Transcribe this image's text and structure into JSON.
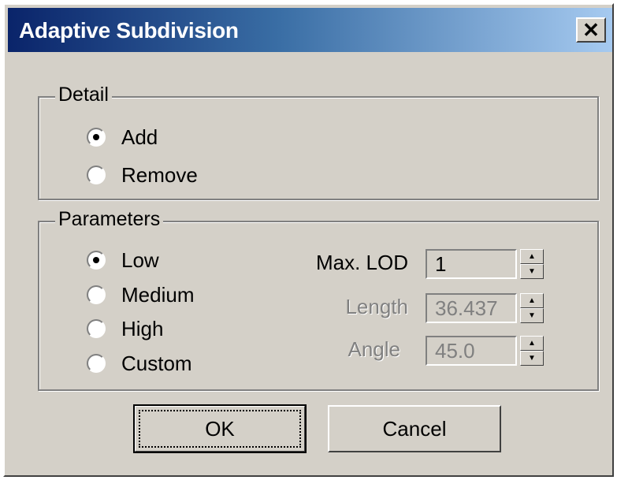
{
  "window": {
    "title": "Adaptive Subdivision",
    "close_glyph": "✕"
  },
  "detail": {
    "label": "Detail",
    "options": [
      {
        "label": "Add",
        "selected": true
      },
      {
        "label": "Remove",
        "selected": false
      }
    ]
  },
  "parameters": {
    "label": "Parameters",
    "options": [
      {
        "label": "Low",
        "selected": true
      },
      {
        "label": "Medium",
        "selected": false
      },
      {
        "label": "High",
        "selected": false
      },
      {
        "label": "Custom",
        "selected": false
      }
    ],
    "fields": [
      {
        "label": "Max. LOD",
        "value": "1",
        "enabled": true
      },
      {
        "label": "Length",
        "value": "36.437",
        "enabled": false
      },
      {
        "label": "Angle",
        "value": "45.0",
        "enabled": false
      }
    ]
  },
  "buttons": {
    "ok": "OK",
    "cancel": "Cancel"
  },
  "icons": {
    "close": "close-icon",
    "spin_up": "spin-up-icon",
    "spin_down": "spin-down-icon"
  }
}
